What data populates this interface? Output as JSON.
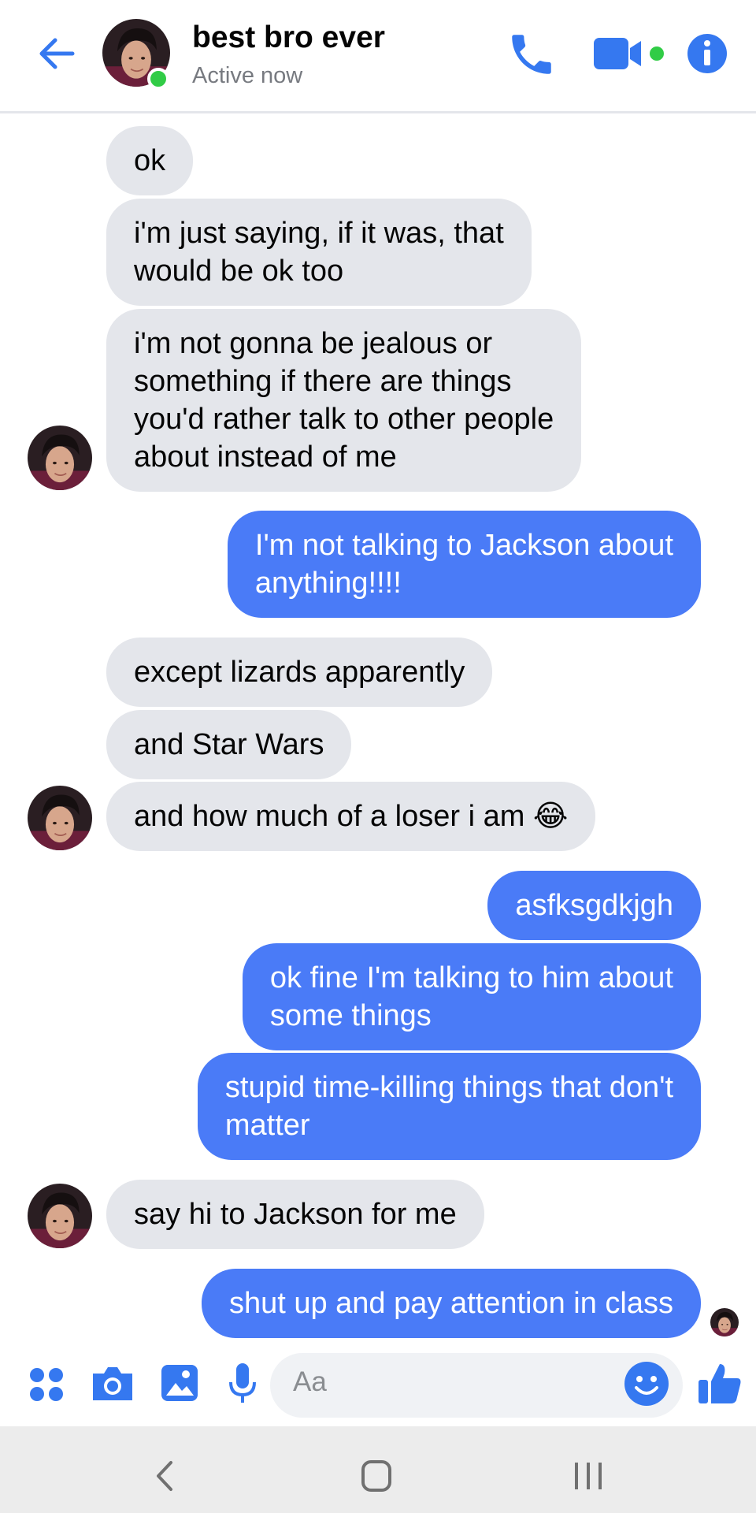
{
  "header": {
    "contact_name": "best bro ever",
    "status": "Active now",
    "presence_color": "#31cc46",
    "icons": [
      "back-arrow-icon",
      "phone-icon",
      "video-camera-icon",
      "info-icon"
    ]
  },
  "messages": [
    {
      "from": "them",
      "text": "ok"
    },
    {
      "from": "them",
      "text": "i'm just saying, if it was, that\nwould be ok too"
    },
    {
      "from": "them",
      "text": "i'm not gonna be jealous or\nsomething if there are things\nyou'd rather talk to other people\nabout instead of me"
    },
    {
      "from": "me",
      "text": "I'm not talking to Jackson about\nanything!!!!"
    },
    {
      "from": "them",
      "text": "except lizards apparently"
    },
    {
      "from": "them",
      "text": "and Star Wars"
    },
    {
      "from": "them",
      "text": "and how much of a loser i am 😂"
    },
    {
      "from": "me",
      "text": "asfksgdkjgh"
    },
    {
      "from": "me",
      "text": "ok fine I'm talking to him about\nsome things"
    },
    {
      "from": "me",
      "text": "stupid time-killing things that don't\nmatter"
    },
    {
      "from": "them",
      "text": "say hi to Jackson for me"
    },
    {
      "from": "me",
      "text": "shut up and pay attention in class"
    }
  ],
  "composer": {
    "placeholder": "Aa",
    "icons": [
      "apps-grid-icon",
      "camera-icon",
      "gallery-icon",
      "microphone-icon",
      "emoji-icon",
      "thumbs-up-icon"
    ]
  },
  "navbar": {
    "icons": [
      "back-nav-icon",
      "home-nav-icon",
      "recents-nav-icon"
    ]
  },
  "colors": {
    "accent": "#4a7bf7",
    "incoming_bubble": "#e4e6eb",
    "outgoing_bubble": "#4a7bf7"
  }
}
